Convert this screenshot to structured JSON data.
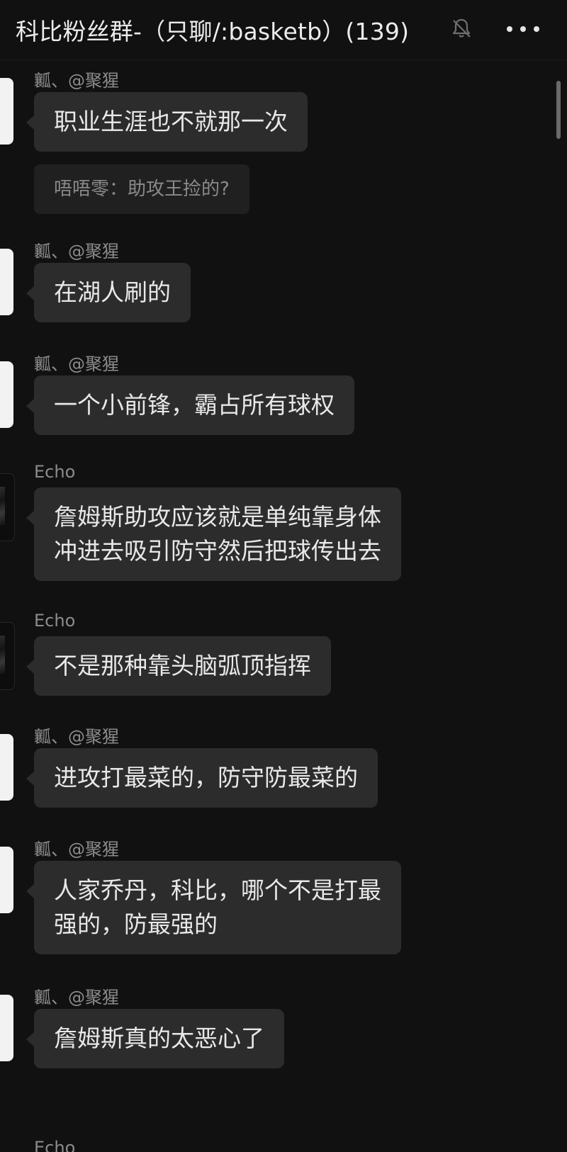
{
  "header": {
    "title": "科比粉丝群-（只聊/:basketb）(139)",
    "mute_icon": "bell-slash-icon",
    "more_icon": "ellipsis-icon"
  },
  "messages": [
    {
      "sender": "瓤、@聚猩",
      "text": "职业生涯也不就那一次",
      "quote": "唔唔零：助攻王捡的?"
    },
    {
      "sender": "瓤、@聚猩",
      "text": "在湖人刷的"
    },
    {
      "sender": "瓤、@聚猩",
      "text": "一个小前锋，霸占所有球权"
    },
    {
      "sender": "Echo",
      "text_lines": [
        "詹姆斯助攻应该就是单纯靠身体",
        "冲进去吸引防守然后把球传出去"
      ]
    },
    {
      "sender": "Echo",
      "text": "不是那种靠头脑弧顶指挥"
    },
    {
      "sender": "瓤、@聚猩",
      "text": "进攻打最菜的，防守防最菜的"
    },
    {
      "sender": "瓤、@聚猩",
      "text_lines": [
        "人家乔丹，科比，哪个不是打最",
        "强的，防最强的"
      ]
    },
    {
      "sender": "瓤、@聚猩",
      "text": "詹姆斯真的太恶心了"
    },
    {
      "sender": "Echo"
    }
  ]
}
